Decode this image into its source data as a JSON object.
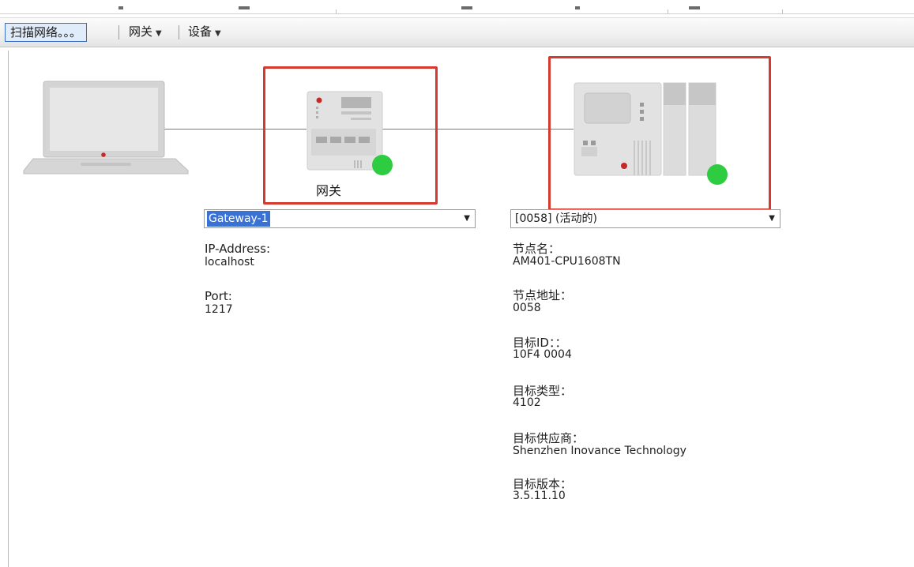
{
  "toolbar": {
    "scan_label": "扫描网络。。。",
    "gateway_label": "网关",
    "device_label": "设备"
  },
  "diagram": {
    "gateway_caption": "网关",
    "status_color": "#2ecc40",
    "highlight_color": "#d63a2f"
  },
  "gateway_panel": {
    "selected": "Gateway-1",
    "ip_label": "IP-Address:",
    "ip_value": "localhost",
    "port_label": "Port:",
    "port_value": "1217"
  },
  "device_panel": {
    "selected": "[0058] (活动的)",
    "fields": [
      {
        "label": "节点名：",
        "value": "AM401-CPU1608TN"
      },
      {
        "label": "节点地址：",
        "value": "0058"
      },
      {
        "label": "目标ID：：",
        "value": "10F4  0004"
      },
      {
        "label": "目标类型：",
        "value": "4102"
      },
      {
        "label": "目标供应商：",
        "value": "Shenzhen Inovance Technology"
      },
      {
        "label": "目标版本：",
        "value": "3.5.11.10"
      }
    ]
  }
}
